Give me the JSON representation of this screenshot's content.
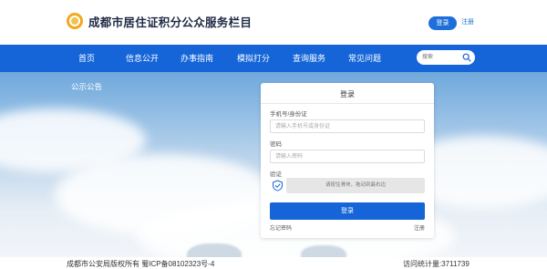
{
  "header": {
    "title": "成都市居住证积分公众服务栏目",
    "login_label": "登录",
    "register_label": "注册"
  },
  "nav": {
    "items": [
      "首页",
      "信息公开",
      "办事指南",
      "模拟打分",
      "查询服务",
      "常见问题"
    ],
    "search_placeholder": "搜索"
  },
  "hero": {
    "notice_label": "公示公告"
  },
  "login_form": {
    "title": "登录",
    "phone_label": "手机号/身份证",
    "phone_placeholder": "请输入手机号或身份证",
    "password_label": "密码",
    "password_placeholder": "请输入密码",
    "captcha_label": "验证",
    "slider_text": "请按住滑块，拖动到最右边",
    "submit_label": "登录",
    "forgot_label": "忘记密码",
    "register_label": "注册"
  },
  "footer": {
    "copyright": "成都市公安局版权所有   蜀ICP备08102323号-4",
    "visit_count": "访问统计量:3711739"
  },
  "colors": {
    "primary": "#1565d8",
    "logo": "#f2a81d"
  }
}
